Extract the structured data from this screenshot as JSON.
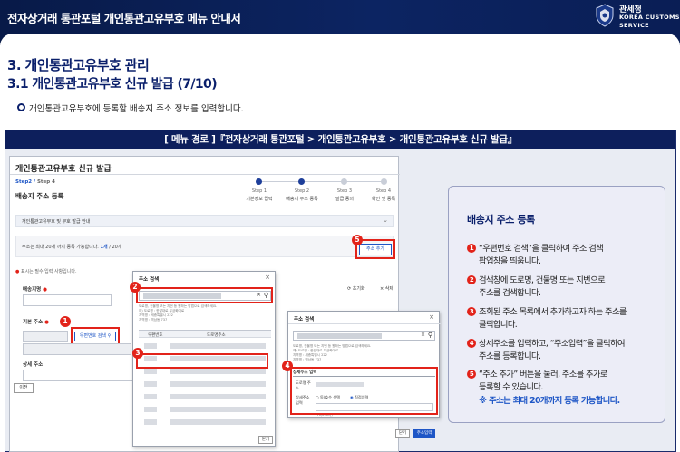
{
  "banner": {
    "title": "전자상거래 통관포털 개인통관고유부호 메뉴 안내서",
    "org_ko": "관세청",
    "org_en_line1": "KOREA CUSTOMS",
    "org_en_line2": "SERVICE",
    "colors": {
      "navy": "#0c2462",
      "accent_red": "#e2231a",
      "link_blue": "#1e56c6"
    }
  },
  "section": {
    "title": "3. 개인통관고유부호 관리",
    "subtitle": "3.1 개인통관고유부호 신규 발급 (7/10)",
    "bullet": "개인통관고유부호에 등록할 배송지 주소 정보를 입력합니다."
  },
  "path_header": "[ 메뉴 경로 ]『전자상거래 통관포털 > 개인통관고유부호 > 개인통관고유부호 신규 발급』",
  "screenshot": {
    "page_title": "개인통관고유부호 신규 발급",
    "step_indicator": {
      "current": "Step2",
      "total": "Step 4"
    },
    "section_title": "배송지 주소 등록",
    "steps": [
      {
        "num": "Step 1",
        "name": "기본정보 입력"
      },
      {
        "num": "Step 2",
        "name": "배송지 주소 등록"
      },
      {
        "num": "Step 3",
        "name": "발급 동의"
      },
      {
        "num": "Step 4",
        "name": "확인 및 등록"
      }
    ],
    "accordion_label": "개인통관고유부호 및 부호 발급 안내",
    "notice_prefix": "주소는 최대 20개 까지 등록 가능합니다.",
    "notice_count": "1개",
    "notice_suffix": "/ 20개",
    "add_address_button": "주소 추가",
    "required_note": "표시는 필수 입력 사항입니다.",
    "shipping_name_label": "배송지명",
    "basic_address_label": "기본 주소",
    "zip_search_button": "우편번호 검색",
    "detail_address_label": "상세 주소",
    "reset_label": "초기화",
    "delete_label": "삭제",
    "prev_button": "이전"
  },
  "popup_search": {
    "title": "주소 검색",
    "tips": [
      "도로명, 건물명 또는 지번 등 원하는 방법으로 검색하세요.",
      "예) 도로명 : 한밭대로 무궁화대로",
      "지역명 : 세종특별시 222",
      "지역명 : 역삼동 737"
    ],
    "col_zip": "우편번호",
    "col_road": "도로명주소",
    "close_button": "닫기"
  },
  "popup_detail": {
    "title": "주소 검색",
    "tips": [
      "도로명, 건물명 또는 지번 등 원하는 방법으로 검색하세요.",
      "예) 도로명 : 한밭대로 무궁화대로",
      "지역명 : 세종특별시 222",
      "지역명 : 역삼동 737"
    ],
    "detail_heading": "상세주소 입력",
    "road_label": "도로명 주소",
    "detail_label": "상세주소 입력",
    "radio_direct": "동/호수 선택",
    "radio_manual": "직접입력",
    "length_hint": "(70/200자)",
    "close_button": "닫기",
    "apply_button": "주소입력"
  },
  "callouts": [
    "1",
    "2",
    "3",
    "4",
    "5"
  ],
  "description": {
    "title": "배송지 주소 등록",
    "items": [
      {
        "num": "1",
        "lines": [
          "“우편번호 검색”을 클릭하여 주소 검색",
          "팝업창을 띄웁니다."
        ]
      },
      {
        "num": "2",
        "lines": [
          "검색창에 도로명, 건물명 또는 지번으로",
          "주소를 검색합니다."
        ]
      },
      {
        "num": "3",
        "lines": [
          "조회된 주소 목록에서 추가하고자 하는 주소를",
          "클릭합니다."
        ]
      },
      {
        "num": "4",
        "lines": [
          "상세주소를 입력하고, “주소입력”을 클릭하여",
          "주소를 등록합니다."
        ]
      },
      {
        "num": "5",
        "lines": [
          "“주소 추가” 버튼을 눌러, 주소를 추가로",
          "등록할 수 있습니다."
        ]
      }
    ],
    "note": "※ 주소는 최대 20개까지 등록 가능합니다."
  }
}
